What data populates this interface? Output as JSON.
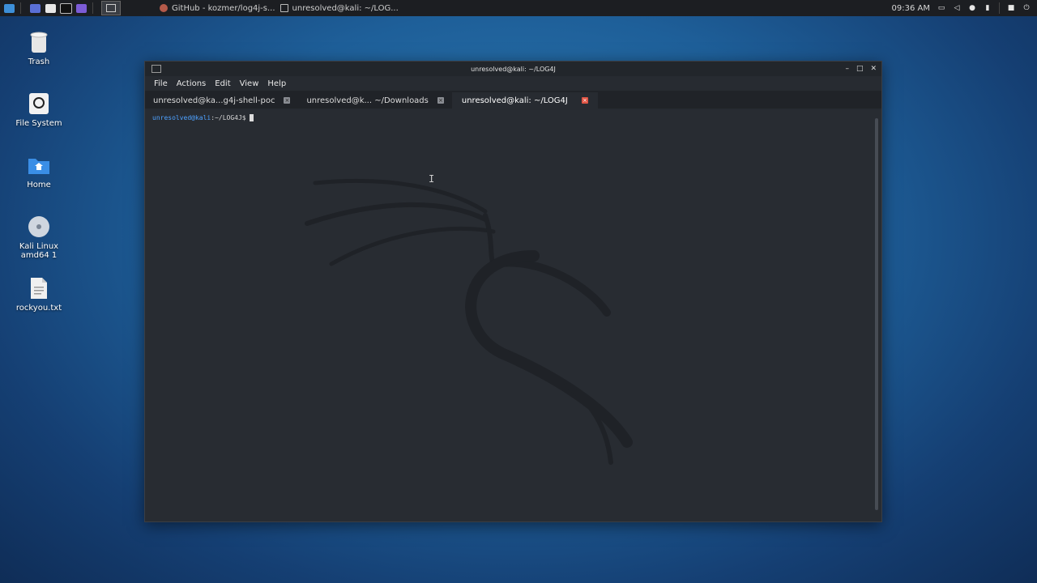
{
  "panel": {
    "taskbar_items": [
      {
        "label": "GitHub - kozmer/log4j-s...",
        "icon": "browser-icon"
      },
      {
        "label": "unresolved@kali: ~/LOG...",
        "icon": "terminal-icon"
      }
    ],
    "clock": "09:36 AM"
  },
  "desktop": {
    "icons": [
      {
        "label": "Trash",
        "icon": "trash-icon"
      },
      {
        "label": "File System",
        "icon": "filesystem-icon"
      },
      {
        "label": "Home",
        "icon": "home-folder-icon"
      },
      {
        "label": "Kali Linux amd64 1",
        "icon": "disc-icon"
      },
      {
        "label": "rockyou.txt",
        "icon": "text-file-icon"
      }
    ]
  },
  "window": {
    "title": "unresolved@kali: ~/LOG4J",
    "menu": [
      "File",
      "Actions",
      "Edit",
      "View",
      "Help"
    ],
    "tabs": [
      {
        "label": "unresolved@ka...g4j-shell-poc",
        "active": false
      },
      {
        "label": "unresolved@k... ~/Downloads",
        "active": false
      },
      {
        "label": "unresolved@kali: ~/LOG4J",
        "active": true
      }
    ],
    "prompt": {
      "user": "unresolved@kali",
      "path": ":~/LOG4J$"
    }
  },
  "colors": {
    "prompt_user": "#4ea1ff",
    "active_tab_close": "#e05545",
    "terminal_bg": "#282c32"
  }
}
